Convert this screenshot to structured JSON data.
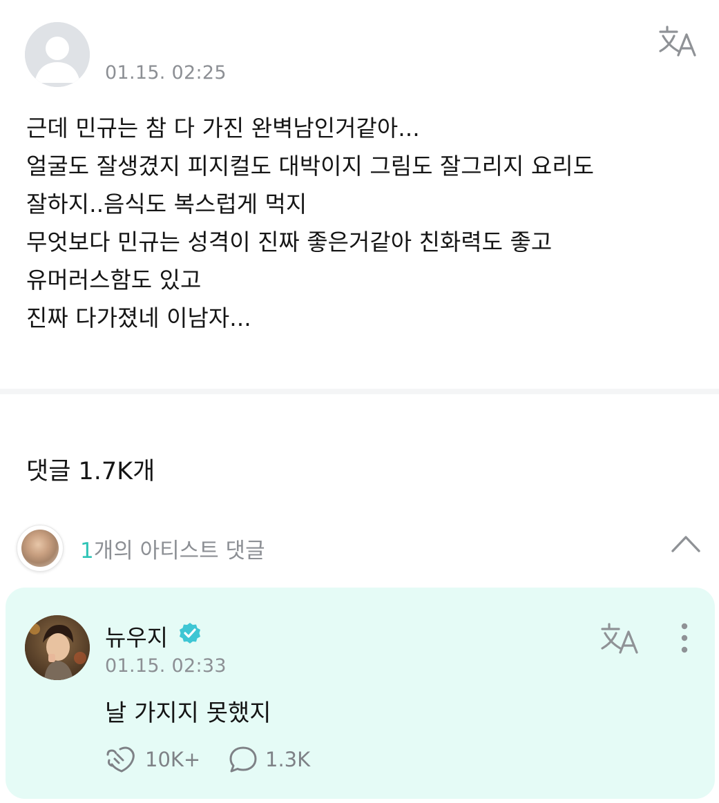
{
  "post": {
    "author": "",
    "time": "01.15. 02:25",
    "avatar_icon": "default-user-avatar",
    "translate_icon": "translate-icon",
    "lines": [
      "근데 민규는 참 다 가진 완벽남인거같아...",
      "얼굴도 잘생겼지 피지컬도 대박이지 그림도 잘그리지 요리도",
      "잘하지..음식도 복스럽게 먹지",
      "무엇보다 민규는 성격이 진짜 좋은거같아 친화력도 좋고",
      "유머러스함도 있고",
      "진짜 다가졌네 이남자..."
    ]
  },
  "comments": {
    "count_label": "댓글 1.7K개"
  },
  "artist_comments": {
    "count": "1",
    "label": "개의 아티스트 댓글",
    "toggle_icon": "chevron-up-icon",
    "accent_color": "#2ec4b6",
    "card_background": "#e5fbf6",
    "item": {
      "name": "뉴우지",
      "verified_icon": "verified-badge-icon",
      "time": "01.15. 02:33",
      "text": "날 가지지 못했지",
      "likes": "10K+",
      "replies": "1.3K"
    }
  }
}
